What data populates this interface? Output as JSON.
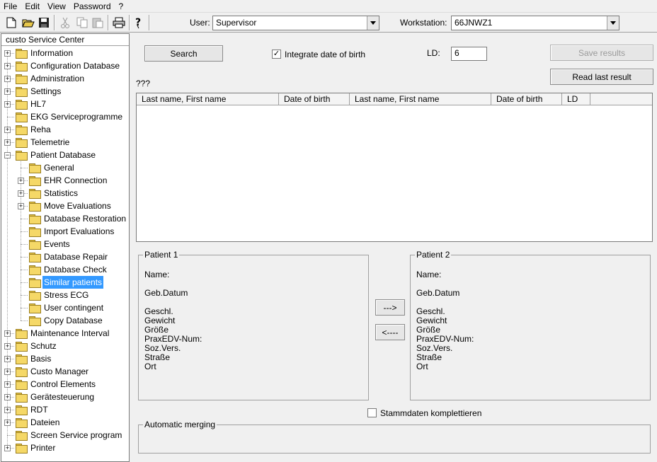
{
  "menu": [
    "File",
    "Edit",
    "View",
    "Password",
    "?"
  ],
  "toolbar": {
    "user_label": "User:",
    "user_value": "Supervisor",
    "workstation_label": "Workstation:",
    "workstation_value": "66JNWZ1",
    "icons": [
      "new-icon",
      "open-icon",
      "save-icon",
      "cut-icon",
      "copy-icon",
      "paste-icon",
      "print-icon",
      "help-icon"
    ]
  },
  "tree": {
    "title": "custo Service Center",
    "items": [
      {
        "label": "Information",
        "level": 0,
        "expander": "+"
      },
      {
        "label": "Configuration Database",
        "level": 0,
        "expander": "+"
      },
      {
        "label": "Administration",
        "level": 0,
        "expander": "+"
      },
      {
        "label": "Settings",
        "level": 0,
        "expander": "+"
      },
      {
        "label": "HL7",
        "level": 0,
        "expander": "+"
      },
      {
        "label": "EKG Serviceprogramme",
        "level": 0,
        "expander": ""
      },
      {
        "label": "Reha",
        "level": 0,
        "expander": "+"
      },
      {
        "label": "Telemetrie",
        "level": 0,
        "expander": "+"
      },
      {
        "label": "Patient Database",
        "level": 0,
        "expander": "-"
      },
      {
        "label": "General",
        "level": 1,
        "expander": ""
      },
      {
        "label": "EHR Connection",
        "level": 1,
        "expander": "+"
      },
      {
        "label": "Statistics",
        "level": 1,
        "expander": "+"
      },
      {
        "label": "Move Evaluations",
        "level": 1,
        "expander": "+"
      },
      {
        "label": "Database Restoration",
        "level": 1,
        "expander": ""
      },
      {
        "label": "Import Evaluations",
        "level": 1,
        "expander": ""
      },
      {
        "label": "Events",
        "level": 1,
        "expander": ""
      },
      {
        "label": "Database Repair",
        "level": 1,
        "expander": ""
      },
      {
        "label": "Database Check",
        "level": 1,
        "expander": ""
      },
      {
        "label": "Similar patients",
        "level": 1,
        "expander": "",
        "selected": true
      },
      {
        "label": "Stress ECG",
        "level": 1,
        "expander": ""
      },
      {
        "label": "User contingent",
        "level": 1,
        "expander": ""
      },
      {
        "label": "Copy Database",
        "level": 1,
        "expander": ""
      },
      {
        "label": "Maintenance Interval",
        "level": 0,
        "expander": "+"
      },
      {
        "label": "Schutz",
        "level": 0,
        "expander": "+"
      },
      {
        "label": "Basis",
        "level": 0,
        "expander": "+"
      },
      {
        "label": "Custo Manager",
        "level": 0,
        "expander": "+"
      },
      {
        "label": "Control Elements",
        "level": 0,
        "expander": "+"
      },
      {
        "label": "Gerätesteuerung",
        "level": 0,
        "expander": "+"
      },
      {
        "label": "RDT",
        "level": 0,
        "expander": "+"
      },
      {
        "label": "Dateien",
        "level": 0,
        "expander": "+"
      },
      {
        "label": "Screen Service program",
        "level": 0,
        "expander": ""
      },
      {
        "label": "Printer",
        "level": 0,
        "expander": "+"
      }
    ]
  },
  "main": {
    "search_label": "Search",
    "integrate_dob_label": "Integrate date of birth",
    "integrate_dob_checked": true,
    "ld_label": "LD:",
    "ld_value": "6",
    "save_results_label": "Save results",
    "read_last_result_label": "Read last result",
    "status_text": "???",
    "grid_columns": [
      "Last name, First name",
      "Date of birth",
      "Last name, First name",
      "Date of birth",
      "LD"
    ],
    "patient1": {
      "legend": "Patient 1",
      "fields": [
        "Name:",
        "Geb.Datum",
        "Geschl.",
        "Gewicht",
        "Größe",
        "PraxEDV-Num:",
        "Soz.Vers.",
        "Straße",
        "Ort"
      ]
    },
    "patient2": {
      "legend": "Patient 2",
      "fields": [
        "Name:",
        "Geb.Datum",
        "Geschl.",
        "Gewicht",
        "Größe",
        "PraxEDV-Num:",
        "Soz.Vers.",
        "Straße",
        "Ort"
      ]
    },
    "move_right_label": "--->",
    "move_left_label": "<----",
    "stammdaten_label": "Stammdaten komplettieren",
    "stammdaten_checked": false,
    "auto_merge_legend": "Automatic merging"
  }
}
